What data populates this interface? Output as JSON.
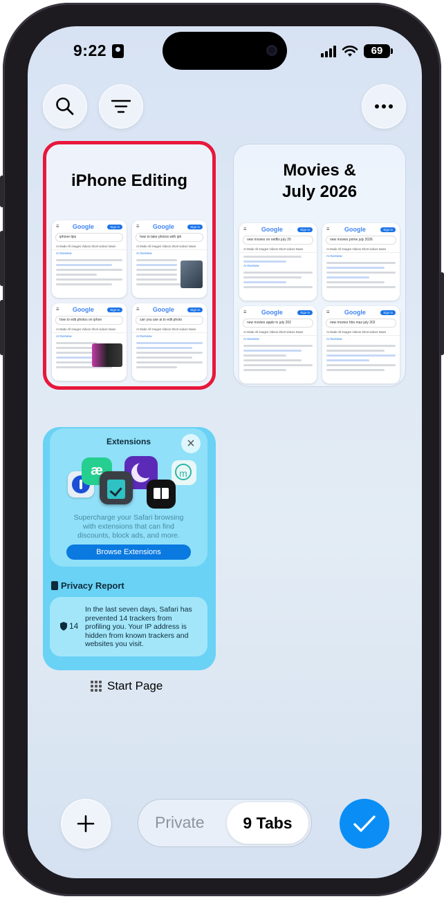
{
  "status_bar": {
    "time": "9:22",
    "battery": "69"
  },
  "toolbar": {
    "search_icon": "search-icon",
    "filter_icon": "filter-icon",
    "more_icon": "more-icon"
  },
  "tab_groups": [
    {
      "title": "iPhone Editing",
      "selected": true,
      "tabs": [
        {
          "search": "iphone tips"
        },
        {
          "search": "how to take photos with iph"
        },
        {
          "search": "how to edit photos on iphon"
        },
        {
          "search": "can you use ai to edit photo"
        }
      ]
    },
    {
      "title_line1": "Movies &",
      "title_line2": "July 2026",
      "tabs": [
        {
          "search": "new movies on netflix july 20"
        },
        {
          "search": "new movies prime july 2026"
        },
        {
          "search": "new movies apple tv july 202"
        },
        {
          "search": "new movies hbo max july 202"
        }
      ]
    }
  ],
  "mini_page": {
    "google": "Google",
    "sign_in": "Sign in",
    "result_tabs": "AI Mode  All  Images  Videos  Short videos  News",
    "ai_overview": "AI Overview"
  },
  "start_page": {
    "extensions_title": "Extensions",
    "close": "×",
    "extensions_desc": "Supercharge your Safari browsing with extensions that can find discounts, block ads, and more.",
    "browse_button": "Browse Extensions",
    "privacy_title": "Privacy Report",
    "tracker_count": "14",
    "privacy_text": "In the last seven days, Safari has prevented 14 trackers from profiling you. Your IP address is hidden from known trackers and websites you visit.",
    "label": "Start Page"
  },
  "bottom": {
    "add": "+",
    "private_label": "Private",
    "tabs_label": "9 Tabs",
    "done_icon": "checkmark-icon"
  },
  "colors": {
    "selected_border": "#e8173b",
    "accent": "#0a8ef5"
  }
}
